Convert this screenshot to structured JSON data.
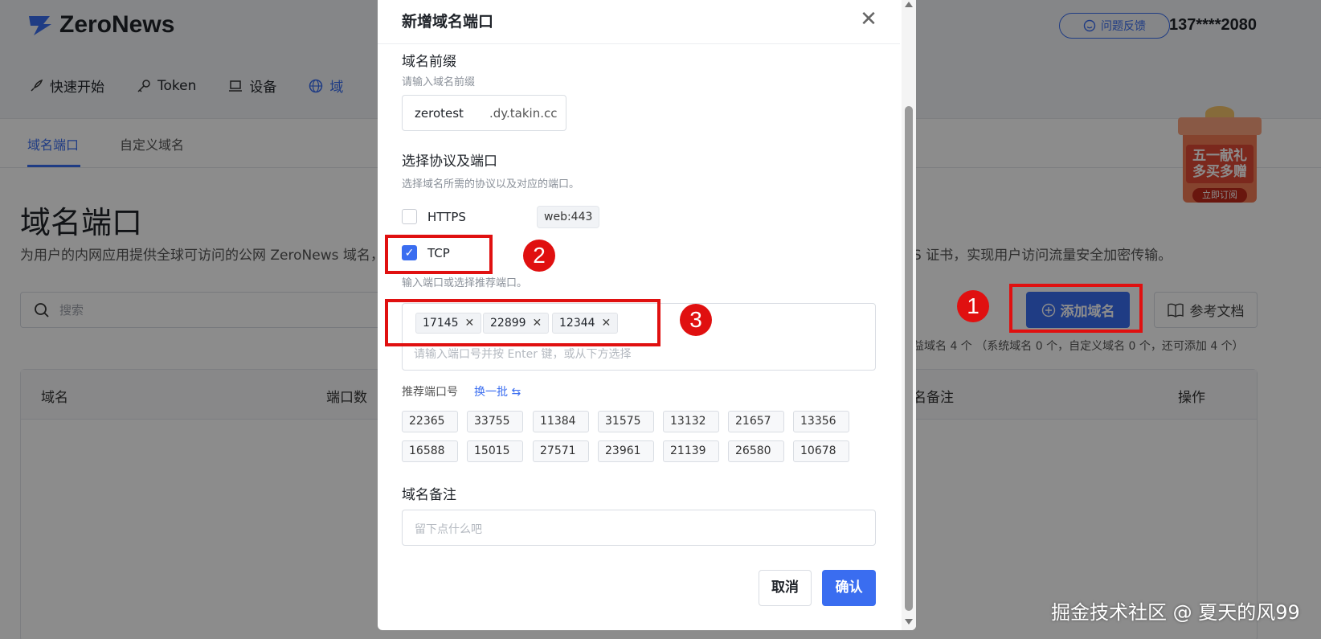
{
  "app": {
    "logo_text": "ZeroNews",
    "feedback_label": "问题反馈",
    "user_phone": "137****2080"
  },
  "nav": {
    "items": [
      {
        "label": "快速开始",
        "icon": "rocket-icon"
      },
      {
        "label": "Token",
        "icon": "key-icon"
      },
      {
        "label": "设备",
        "icon": "laptop-icon"
      },
      {
        "label": "域",
        "icon": "globe-icon"
      }
    ]
  },
  "subnav": {
    "tabs": [
      {
        "label": "域名端口",
        "active": true
      },
      {
        "label": "自定义域名",
        "active": false
      }
    ]
  },
  "page": {
    "title": "域名端口",
    "desc_left": "为用户的内网应用提供全球可访问的公网 ZeroNews 域名，",
    "desc_right": "S 证书，实现用户访问流量安全加密传输。",
    "search_placeholder": "搜索",
    "add_domain_label": "添加域名",
    "doc_label": "参考文档",
    "quota_text": "益域名 4 个 （系统域名 0 个，自定义域名 0 个，还可添加 4 个）",
    "table_headers": {
      "domain": "域名",
      "port_count": "端口数",
      "note": "名备注",
      "actions": "操作"
    }
  },
  "promo": {
    "line1": "五一献礼",
    "line2": "多买多赠",
    "button": "立即订阅"
  },
  "modal": {
    "title": "新增域名端口",
    "close_icon": "close-icon",
    "prefix": {
      "label": "域名前缀",
      "hint": "请输入域名前缀",
      "value": "zerotest",
      "suffix": ".dy.takin.cc"
    },
    "protocol": {
      "label": "选择协议及端口",
      "hint": "选择域名所需的协议以及对应的端口。",
      "https": {
        "label": "HTTPS",
        "checked": false,
        "port": "web:443"
      },
      "tcp": {
        "label": "TCP",
        "checked": true
      },
      "ports_hint": "输入端口或选择推荐端口。",
      "selected_ports": [
        "17145",
        "22899",
        "12344"
      ],
      "ports_placeholder": "请输入端口号并按 Enter 键，或从下方选择"
    },
    "recommended": {
      "label": "推荐端口号",
      "refresh_label": "换一批",
      "row1": [
        "22365",
        "33755",
        "11384",
        "31575",
        "13132",
        "21657",
        "13356"
      ],
      "row2": [
        "16588",
        "15015",
        "27571",
        "23961",
        "21139",
        "26580",
        "10678"
      ]
    },
    "note": {
      "label": "域名备注",
      "placeholder": "留下点什么吧"
    },
    "cancel_label": "取消",
    "confirm_label": "确认"
  },
  "annotations": {
    "n1": "1",
    "n2": "2",
    "n3": "3",
    "color": "#e01010"
  },
  "watermark": "掘金技术社区 @ 夏天的风99",
  "colors": {
    "accent": "#3a6df0",
    "overlay": "rgba(0,0,0,0.45)"
  }
}
